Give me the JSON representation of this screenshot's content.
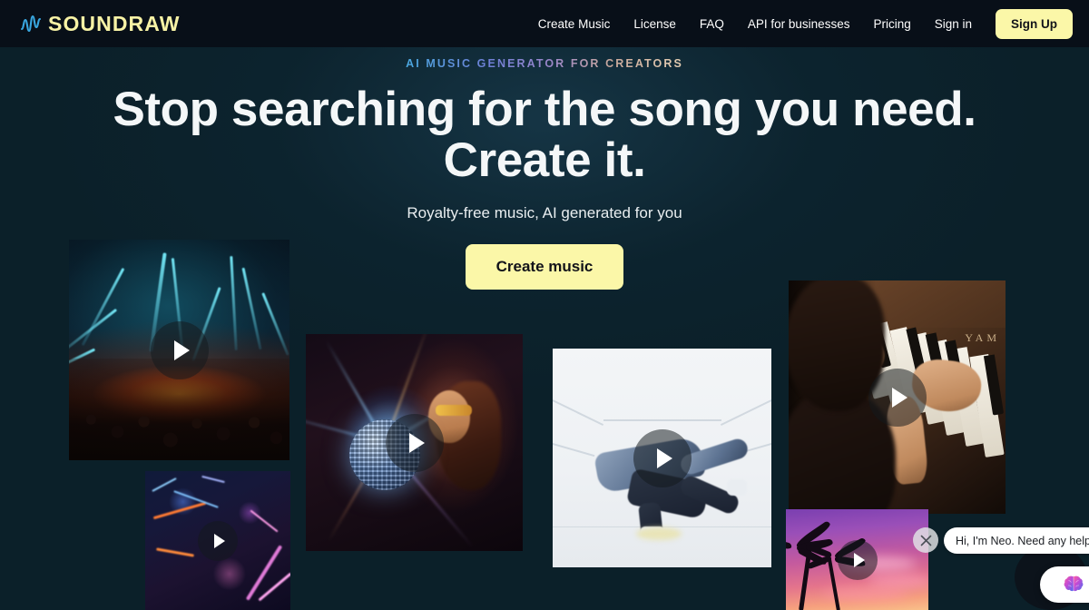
{
  "brand": {
    "logo_text": "SOUNDRAW",
    "logo_wave_icon": "waveform-icon",
    "logo_text_color": "#f7f2a5",
    "logo_wave_color": "#39a7e0"
  },
  "header": {
    "background_color": "#080f18",
    "nav_items": [
      {
        "label": "Create Music"
      },
      {
        "label": "License"
      },
      {
        "label": "FAQ"
      },
      {
        "label": "API for businesses"
      },
      {
        "label": "Pricing"
      },
      {
        "label": "Sign in"
      }
    ],
    "signup_label": "Sign Up",
    "signup_bg": "#fbf7a8"
  },
  "hero": {
    "eyebrow": "AI MUSIC GENERATOR FOR CREATORS",
    "headline_line1": "Stop searching for the song you need.",
    "headline_line2": "Create it.",
    "subtitle": "Royalty-free music, AI generated for you",
    "cta_label": "Create music",
    "cta_bg": "#fbf7a8",
    "background_color": "#0b2029"
  },
  "gallery": {
    "play_icon": "play-icon",
    "cards": [
      {
        "id": "concert",
        "alt": "Concert crowd with teal laser beams and orange stage light"
      },
      {
        "id": "city",
        "alt": "Aerial night cityscape with neon lights"
      },
      {
        "id": "disco",
        "alt": "Woman with sunglasses holding a mirror disco ball"
      },
      {
        "id": "dancer",
        "alt": "Dancer mid-move in a bright white corridor"
      },
      {
        "id": "piano",
        "alt": "Hands playing an upright Yamaha piano"
      },
      {
        "id": "sunset",
        "alt": "Palm trees against a purple and pink tropical sunset"
      }
    ],
    "piano_brand_text": "YAM"
  },
  "chat_widget": {
    "message": "Hi, I'm Neo. Need any help?",
    "close_icon": "close-icon",
    "launcher_icon": "brain-icon",
    "bubble_bg": "#ffffff"
  }
}
